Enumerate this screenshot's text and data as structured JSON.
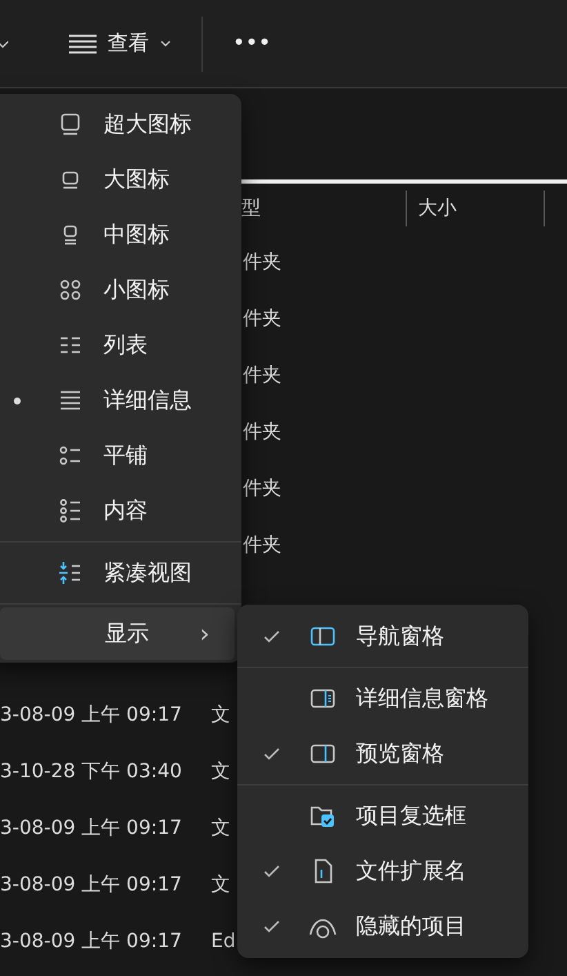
{
  "toolbar": {
    "view_button": "查看",
    "more_button": "•••"
  },
  "file_list": {
    "columns": [
      "型",
      "大小"
    ],
    "rows": [
      {
        "type": "件夹"
      },
      {
        "type": "件夹"
      },
      {
        "type": "件夹"
      },
      {
        "type": "件夹"
      },
      {
        "type": "件夹"
      },
      {
        "type": "件夹"
      },
      {
        "date": "3-08-09 上午 09:17",
        "type": "文"
      },
      {
        "date": "3-10-28 下午 03:40",
        "type": "文"
      },
      {
        "date": "3-08-09 上午 09:17",
        "type": "文"
      },
      {
        "date": "3-08-09 上午 09:17",
        "type": "文"
      },
      {
        "date": "3-08-09 上午 09:17",
        "type": "Ed"
      }
    ]
  },
  "view_menu": {
    "layouts": [
      {
        "label": "超大图标",
        "selected": false
      },
      {
        "label": "大图标",
        "selected": false
      },
      {
        "label": "中图标",
        "selected": false
      },
      {
        "label": "小图标",
        "selected": false
      },
      {
        "label": "列表",
        "selected": false
      },
      {
        "label": "详细信息",
        "selected": true
      },
      {
        "label": "平铺",
        "selected": false
      },
      {
        "label": "内容",
        "selected": false
      }
    ],
    "compact_view": {
      "label": "紧凑视图",
      "checked": false
    },
    "show_item": {
      "label": "显示",
      "chevron": "›",
      "highlighted": true
    }
  },
  "show_menu": {
    "items": [
      {
        "label": "导航窗格",
        "checked": true,
        "divider_after": true
      },
      {
        "label": "详细信息窗格",
        "checked": false
      },
      {
        "label": "预览窗格",
        "checked": true,
        "divider_after": true
      },
      {
        "label": "项目复选框",
        "checked": false
      },
      {
        "label": "文件扩展名",
        "checked": true
      },
      {
        "label": "隐藏的项目",
        "checked": true
      }
    ]
  }
}
